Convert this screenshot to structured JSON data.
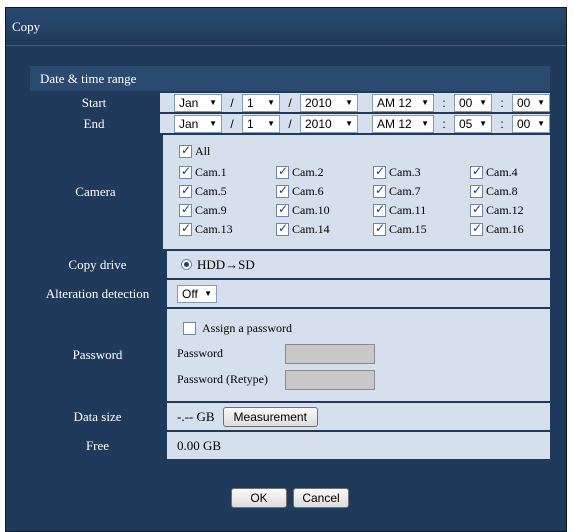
{
  "window": {
    "title": "Copy"
  },
  "section": {
    "date_time_header": "Date & time range"
  },
  "start": {
    "label": "Start",
    "month": "Jan",
    "day": "1",
    "year": "2010",
    "ampm_hour": "AM 12",
    "minute": "00",
    "second": "00"
  },
  "end": {
    "label": "End",
    "month": "Jan",
    "day": "1",
    "year": "2010",
    "ampm_hour": "AM 12",
    "minute": "05",
    "second": "00"
  },
  "separators": {
    "date": "/",
    "time": ":"
  },
  "camera": {
    "label": "Camera",
    "all_label": "All",
    "cams": [
      "Cam.1",
      "Cam.2",
      "Cam.3",
      "Cam.4",
      "Cam.5",
      "Cam.6",
      "Cam.7",
      "Cam.8",
      "Cam.9",
      "Cam.10",
      "Cam.11",
      "Cam.12",
      "Cam.13",
      "Cam.14",
      "Cam.15",
      "Cam.16"
    ]
  },
  "copy_drive": {
    "label": "Copy drive",
    "option": "HDD→SD"
  },
  "alteration": {
    "label": "Alteration detection",
    "value": "Off"
  },
  "password": {
    "label": "Password",
    "assign_label": "Assign a password",
    "password_label": "Password",
    "retype_label": "Password (Retype)"
  },
  "data_size": {
    "label": "Data size",
    "value": "-.-- GB",
    "measure_button": "Measurement"
  },
  "free": {
    "label": "Free",
    "value": "0.00 GB"
  },
  "buttons": {
    "ok": "OK",
    "cancel": "Cancel"
  }
}
